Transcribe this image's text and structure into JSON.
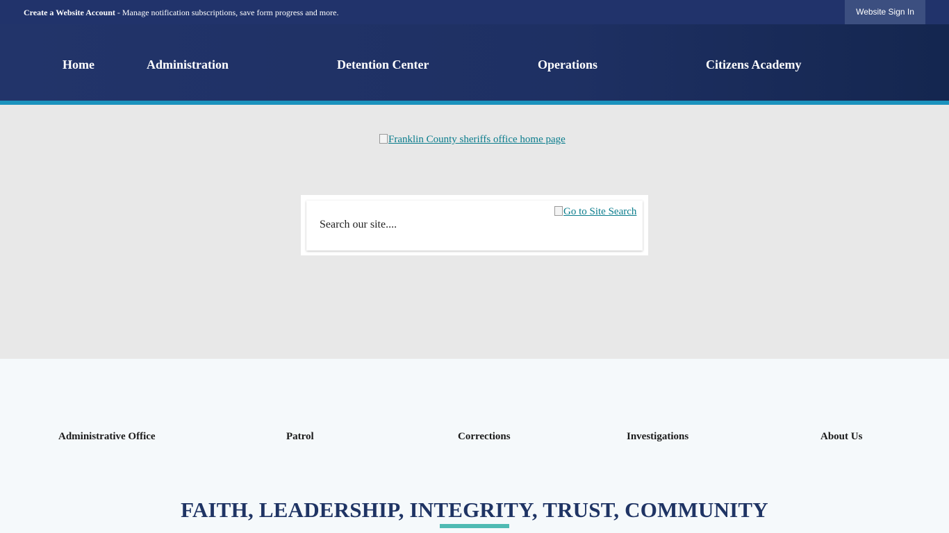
{
  "topbar": {
    "account_link": "Create a Website Account",
    "message": " - Manage notification subscriptions, save form progress and more.",
    "signin_label": "Website Sign In"
  },
  "nav": {
    "items": [
      {
        "label": "Home"
      },
      {
        "label": "Administration"
      },
      {
        "label": "Detention Center"
      },
      {
        "label": "Operations"
      },
      {
        "label": "Citizens Academy"
      }
    ]
  },
  "hero": {
    "logo_alt": "Franklin County sheriffs office home page",
    "search_placeholder": "Search our site....",
    "search_button_alt": "Go to Site Search"
  },
  "quick_links": [
    {
      "label": "Administrative Office"
    },
    {
      "label": "Patrol"
    },
    {
      "label": "Corrections"
    },
    {
      "label": "Investigations"
    },
    {
      "label": "About Us"
    }
  ],
  "motto": "FAITH, LEADERSHIP, INTEGRITY, TRUST, COMMUNITY",
  "colors": {
    "topbar": "#21336b",
    "nav": "#1e3063",
    "nav_accent": "#1b92bd",
    "hero_bg": "#e8e8e8",
    "link": "#0a7c8c",
    "motto": "#1f3464",
    "motto_underline": "#4fbab3"
  }
}
